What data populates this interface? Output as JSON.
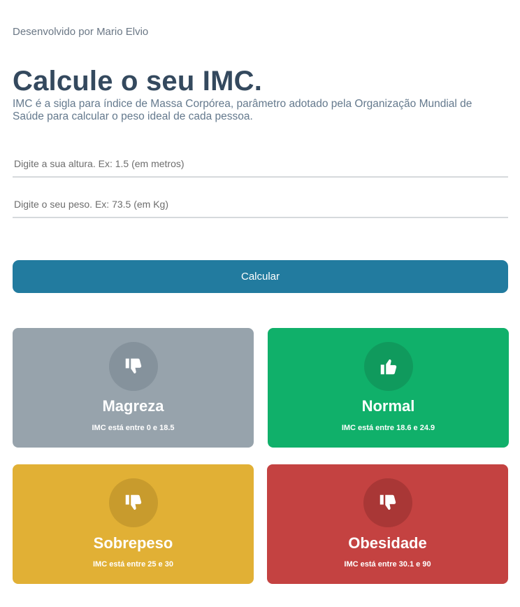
{
  "header": {
    "credit": "Desenvolvido por Mario Elvio",
    "title": "Calcule o seu IMC.",
    "description": "IMC é a sigla para índice de Massa Corpórea, parâmetro adotado pela Organização Mundial de Saúde para calcular o peso ideal de cada pessoa."
  },
  "form": {
    "height_value": "",
    "height_placeholder": "Digite a sua altura. Ex: 1.5 (em metros)",
    "weight_value": "",
    "weight_placeholder": "Digite o seu peso. Ex: 73.5 (em Kg)",
    "submit_label": "Calcular"
  },
  "cards": [
    {
      "title": "Magreza",
      "range_prefix": "IMC está entre ",
      "min": "0",
      "conj": " e ",
      "max": "18.5",
      "icon": "thumbs-down-icon",
      "color": "#97a3ac"
    },
    {
      "title": "Normal",
      "range_prefix": "IMC está entre ",
      "min": "18.6",
      "conj": " e ",
      "max": "24.9",
      "icon": "thumbs-up-icon",
      "color": "#10b06a"
    },
    {
      "title": "Sobrepeso",
      "range_prefix": "IMC está entre ",
      "min": "25",
      "conj": " e ",
      "max": "30",
      "icon": "thumbs-down-icon",
      "color": "#e1b035"
    },
    {
      "title": "Obesidade",
      "range_prefix": "IMC está entre ",
      "min": "30.1",
      "conj": " e ",
      "max": "90",
      "icon": "thumbs-down-icon",
      "color": "#c44241"
    }
  ]
}
